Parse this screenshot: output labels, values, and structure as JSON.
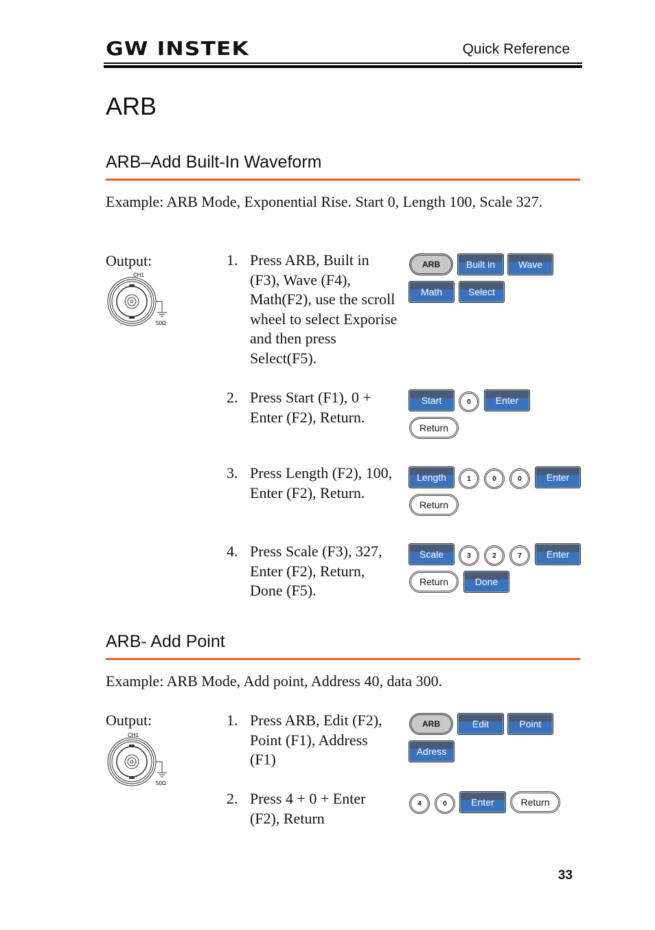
{
  "header": {
    "logo": "GW INSTEK",
    "section": "Quick Reference"
  },
  "title": "ARB",
  "sections": [
    {
      "heading": "ARB–Add Built-In Waveform",
      "example": "Example: ARB Mode, Exponential Rise. Start 0, Length 100, Scale 327.",
      "output_label": "Output:",
      "connector": {
        "channel": "CH1",
        "impedance": "50Ω"
      },
      "steps": [
        {
          "num": "1.",
          "text": "Press ARB, Built in (F3), Wave (F4), Math(F2), use the scroll wheel to select Exporise and then press Select(F5).",
          "keys": [
            "ARB",
            "Built in",
            "Wave",
            "Math",
            "Select"
          ]
        },
        {
          "num": "2.",
          "text": "Press Start (F1), 0 + Enter (F2), Return.",
          "keys": [
            "Start",
            "0",
            "Enter",
            "Return"
          ]
        },
        {
          "num": "3.",
          "text": "Press Length (F2), 100, Enter (F2), Return.",
          "keys": [
            "Length",
            "1",
            "0",
            "0",
            "Enter",
            "Return"
          ]
        },
        {
          "num": "4.",
          "text": "Press Scale (F3), 327, Enter (F2), Return, Done (F5).",
          "keys": [
            "Scale",
            "3",
            "2",
            "7",
            "Enter",
            "Return",
            "Done"
          ]
        }
      ]
    },
    {
      "heading": "ARB- Add Point",
      "example": "Example: ARB Mode, Add point, Address 40, data 300.",
      "output_label": "Output:",
      "connector": {
        "channel": "CH1",
        "impedance": "50Ω"
      },
      "steps": [
        {
          "num": "1.",
          "text": "Press ARB, Edit (F2), Point (F1), Address (F1)",
          "keys": [
            "ARB",
            "Edit",
            "Point",
            "Adress"
          ]
        },
        {
          "num": "2.",
          "text": "Press 4 + 0 + Enter (F2), Return",
          "keys": [
            "4",
            "0",
            "Enter",
            "Return"
          ]
        }
      ]
    }
  ],
  "page_number": "33",
  "colors": {
    "accent_rule": "#e8601c",
    "softkey_blue": "#3a72be",
    "softkey_top": "#4a5a78"
  }
}
